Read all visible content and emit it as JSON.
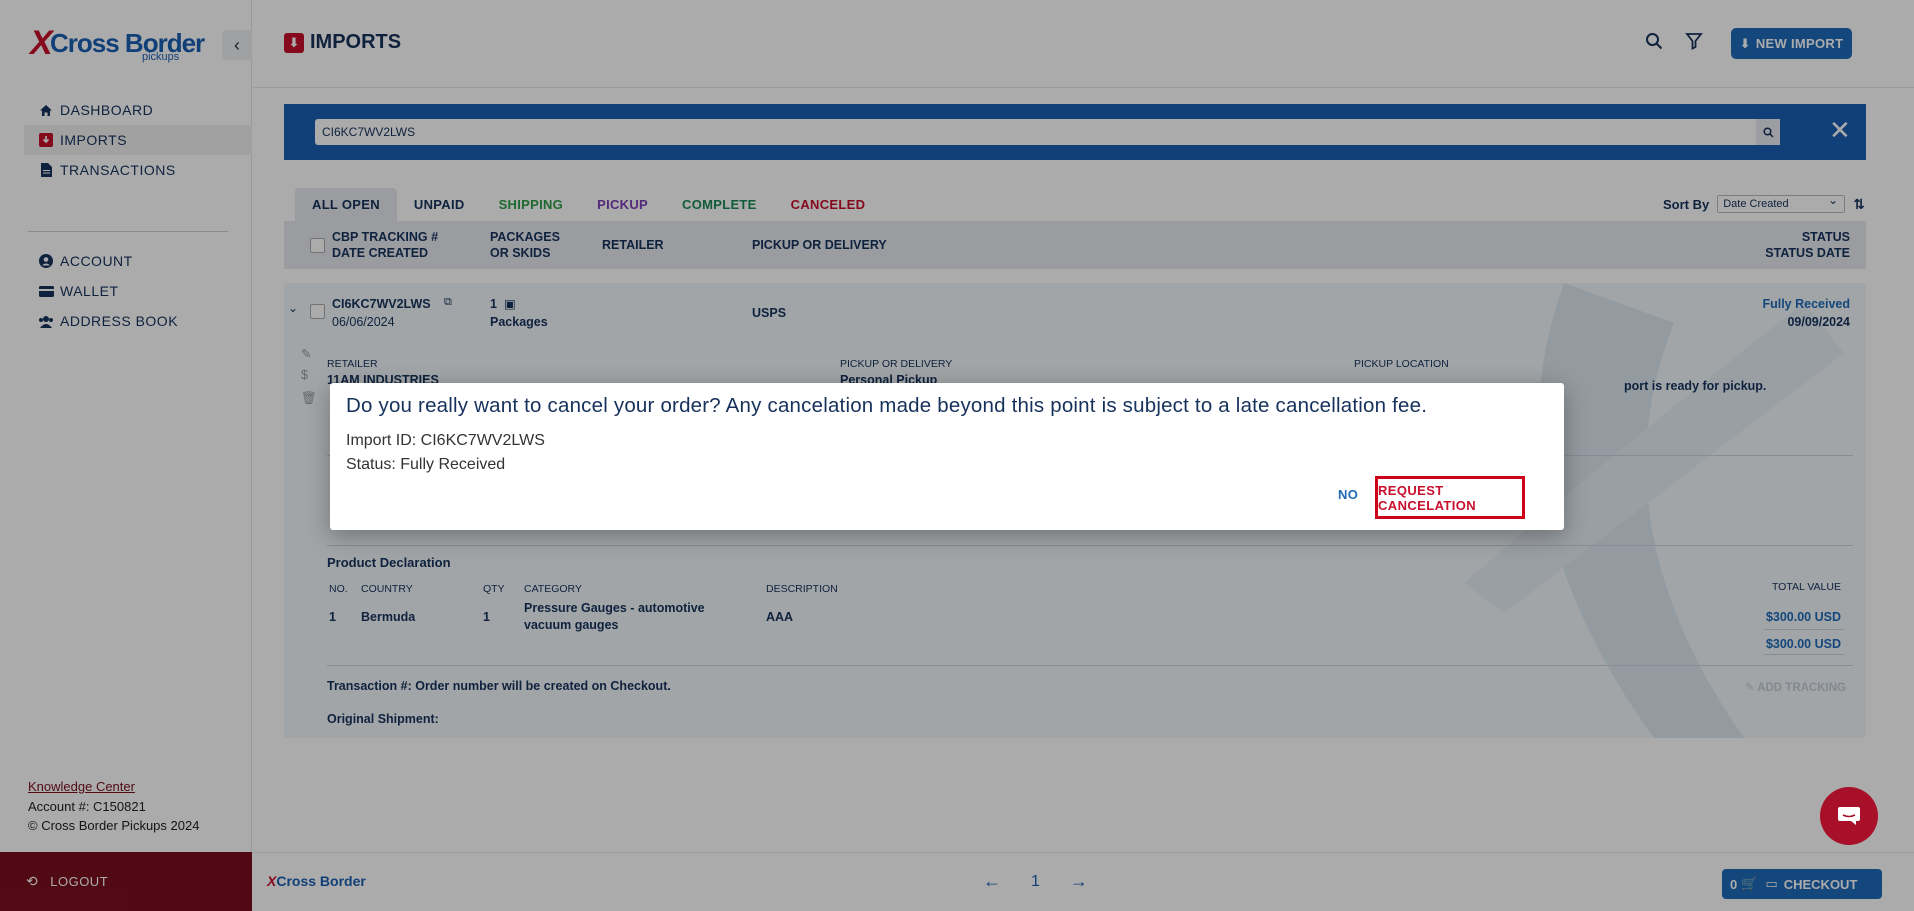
{
  "brand": {
    "name": "Cross Border",
    "sub": "pickups",
    "footer_name": "Cross Border"
  },
  "sidebar": {
    "collapse": "‹",
    "items": [
      {
        "label": "DASHBOARD",
        "icon": "home-icon"
      },
      {
        "label": "IMPORTS",
        "icon": "imports-icon"
      },
      {
        "label": "TRANSACTIONS",
        "icon": "document-icon"
      },
      {
        "label": "ACCOUNT",
        "icon": "user-icon"
      },
      {
        "label": "WALLET",
        "icon": "wallet-icon"
      },
      {
        "label": "ADDRESS BOOK",
        "icon": "address-book-icon"
      }
    ],
    "knowledge_center": "Knowledge Center",
    "account": "Account #: C150821",
    "copyright": "© Cross Border Pickups 2024",
    "logout": "LOGOUT"
  },
  "header": {
    "title": "IMPORTS",
    "new_import": "NEW IMPORT"
  },
  "search": {
    "value": "CI6KC7WV2LWS"
  },
  "tabs": [
    {
      "label": "ALL OPEN",
      "color": "#16325c"
    },
    {
      "label": "UNPAID",
      "color": "#16325c"
    },
    {
      "label": "SHIPPING",
      "color": "#2e9e4a"
    },
    {
      "label": "PICKUP",
      "color": "#7b3fb5"
    },
    {
      "label": "COMPLETE",
      "color": "#1c8a57"
    },
    {
      "label": "CANCELED",
      "color": "#c8102e"
    }
  ],
  "sort": {
    "label": "Sort By",
    "value": "Date Created"
  },
  "table_head": {
    "col1a": "CBP TRACKING #",
    "col1b": "DATE CREATED",
    "col2a": "PACKAGES",
    "col2b": "OR SKIDS",
    "col3": "RETAILER",
    "col4": "PICKUP OR DELIVERY",
    "col5a": "STATUS",
    "col5b": "STATUS DATE"
  },
  "order": {
    "tracking": "CI6KC7WV2LWS",
    "date": "06/06/2024",
    "packages_count": "1",
    "packages_label": "Packages",
    "carrier": "USPS",
    "status": "Fully Received",
    "status_date": "09/09/2024",
    "retailer_label": "RETAILER",
    "retailer": "11AM INDUSTRIES",
    "pickup_label": "PICKUP OR DELIVERY",
    "pickup": "Personal Pickup",
    "location_label": "PICKUP LOCATION",
    "ready_note": "port is ready for pickup.",
    "product_declaration": "Product Declaration",
    "pd_headers": {
      "no": "NO.",
      "country": "COUNTRY",
      "qty": "QTY",
      "category": "CATEGORY",
      "description": "DESCRIPTION",
      "total": "TOTAL VALUE"
    },
    "pd_row": {
      "no": "1",
      "country": "Bermuda",
      "qty": "1",
      "category_1": "Pressure Gauges - automotive",
      "category_2": "vacuum gauges",
      "description": "AAA",
      "total": "$300.00 USD"
    },
    "pd_sum": "$300.00 USD",
    "transaction": "Transaction #: Order number will be created on Checkout.",
    "add_tracking": "ADD TRACKING",
    "original_shipment": "Original Shipment:"
  },
  "footer": {
    "page": "1",
    "cart_count": "0",
    "checkout": "CHECKOUT"
  },
  "modal": {
    "title": "Do you really want to cancel your order? Any cancelation made beyond this point is subject to a late cancellation fee.",
    "import_id": "Import ID: CI6KC7WV2LWS",
    "status": "Status: Fully Received",
    "no": "NO",
    "request": "REQUEST CANCELATION"
  }
}
